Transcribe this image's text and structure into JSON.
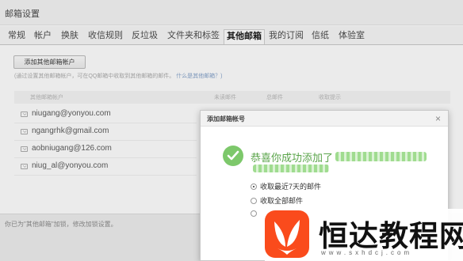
{
  "window": {
    "title": "邮箱设置"
  },
  "tabs": [
    {
      "label": "常规"
    },
    {
      "label": "帐户"
    },
    {
      "label": "换肤"
    },
    {
      "label": "收信规则"
    },
    {
      "label": "反垃圾"
    },
    {
      "label": "文件夹和标签"
    },
    {
      "label": "其他邮箱",
      "active": true
    },
    {
      "label": "我的订阅"
    },
    {
      "label": "信纸"
    },
    {
      "label": "体验室"
    }
  ],
  "main": {
    "add_button_label": "添加其他邮箱帐户",
    "hint_text": "(通过设置其他邮箱帐户，可在QQ邮箱中收取到其他邮箱的邮件。",
    "hint_link": "什么是其他邮箱？)",
    "table": {
      "headers": [
        "其他邮箱帐户",
        "未读邮件",
        "总邮件",
        "收取提示"
      ],
      "rows": [
        {
          "email": "niugang@yonyou.com"
        },
        {
          "email": "ngangrhk@gmail.com"
        },
        {
          "email": "aobniugang@126.com"
        },
        {
          "email": "niug_al@yonyou.com"
        }
      ]
    },
    "footer_tip": "你已为\"其他邮箱\"加锁，修改加锁设置。"
  },
  "dialog": {
    "title": "添加邮箱帐号",
    "close_glyph": "×",
    "success_text": "恭喜你成功添加了",
    "options": [
      {
        "label": "收取最近7天的邮件",
        "checked": true
      },
      {
        "label": "收取全部邮件",
        "checked": false
      },
      {
        "label": "",
        "checked": false
      }
    ]
  },
  "watermark": {
    "text": "恒达教程网",
    "url": "www.sxhdcj.com"
  },
  "colors": {
    "success_green": "#5aa44a",
    "check_green": "#7dc86b",
    "logo_orange": "#fa4b1c"
  },
  "icons": {
    "mail": "mail-icon",
    "success": "check-icon",
    "close": "close-icon"
  }
}
